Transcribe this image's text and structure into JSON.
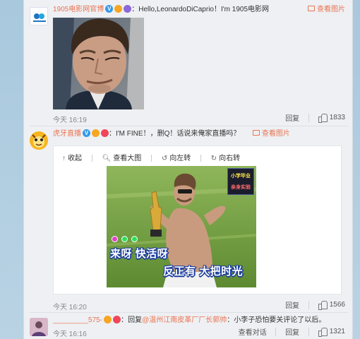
{
  "comments": [
    {
      "username": "1905电影网官博",
      "text": "：Hello,LeonardoDiCaprio！I'm 1905电影网",
      "view_pic": "查看图片",
      "time": "今天 16:19",
      "reply": "回复",
      "likes": "1833"
    },
    {
      "username": "虎牙直播",
      "text": "：I'M FINE！，删Q！话说来俺家直播吗？",
      "view_pic": "查看图片",
      "time": "今天 16:20",
      "reply": "回复",
      "likes": "1566",
      "viewer": {
        "collapse": "收起",
        "view_large": "查看大图",
        "rotate_left": "向左转",
        "rotate_right": "向右转",
        "subtitle_1": "来呀 快活呀",
        "subtitle_2": "反正有 大把时光",
        "stamp_line_1": "小学毕业",
        "stamp_line_2": "亲身实验"
      }
    },
    {
      "username": "_________575-",
      "text_prefix": "：回复",
      "mention": "@温州江南皮革厂厂长郭帅",
      "text": "：小李子恐怕要关评论了以后。",
      "time": "今天 16:16",
      "view_conversation": "查看对话",
      "reply": "回复",
      "likes": "1321"
    }
  ],
  "colors": {
    "accent": "#eb7350",
    "verified": "#3399ea",
    "meme_subtitle_outline": "#1a3b9e"
  },
  "icons": [
    "verified-icon",
    "badge-icon",
    "picture-icon",
    "thumbs-up-icon",
    "collapse-icon",
    "zoom-icon",
    "rotate-left-icon",
    "rotate-right-icon"
  ]
}
